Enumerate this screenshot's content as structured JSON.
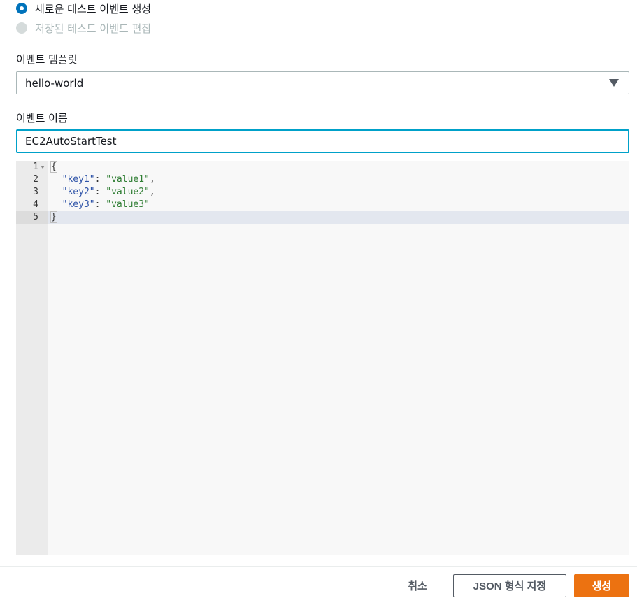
{
  "radio_options": [
    {
      "label": "새로운 테스트 이벤트 생성",
      "selected": true,
      "disabled": false
    },
    {
      "label": "저장된 테스트 이벤트 편집",
      "selected": false,
      "disabled": true
    }
  ],
  "template": {
    "label": "이벤트 템플릿",
    "value": "hello-world"
  },
  "event_name": {
    "label": "이벤트 이름",
    "value": "EC2AutoStartTest"
  },
  "editor": {
    "line_numbers": [
      "1",
      "2",
      "3",
      "4",
      "5"
    ],
    "lines": [
      {
        "open": "{"
      },
      {
        "key": "\"key1\"",
        "sep": ": ",
        "val": "\"value1\"",
        "end": ","
      },
      {
        "key": "\"key2\"",
        "sep": ": ",
        "val": "\"value2\"",
        "end": ","
      },
      {
        "key": "\"key3\"",
        "sep": ": ",
        "val": "\"value3\"",
        "end": ""
      },
      {
        "close": "}"
      }
    ],
    "active_line": 5
  },
  "footer": {
    "cancel_label": "취소",
    "format_label": "JSON 형식 지정",
    "create_label": "생성"
  },
  "colors": {
    "radio_selected": "#0073bb",
    "focus_border": "#00a1c9",
    "primary_button": "#ec7211",
    "json_key": "#2f54a8",
    "json_string": "#2e7d32"
  }
}
